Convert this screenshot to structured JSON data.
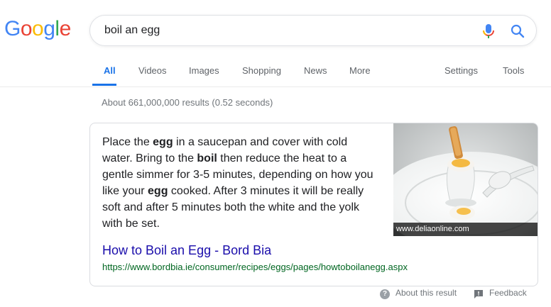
{
  "logo": {
    "letters": [
      "G",
      "o",
      "o",
      "g",
      "l",
      "e"
    ],
    "colors": [
      "#4285f4",
      "#ea4335",
      "#fbbc05",
      "#4285f4",
      "#34a853",
      "#ea4335"
    ]
  },
  "search": {
    "query": "boil an egg"
  },
  "tabs": [
    {
      "label": "All",
      "active": true
    },
    {
      "label": "Videos"
    },
    {
      "label": "Images"
    },
    {
      "label": "Shopping"
    },
    {
      "label": "News"
    },
    {
      "label": "More"
    },
    {
      "label": "Settings"
    },
    {
      "label": "Tools"
    }
  ],
  "stats": "About 661,000,000 results (0.52 seconds)",
  "featured": {
    "snippet_parts": [
      {
        "text": "Place the ",
        "bold": false
      },
      {
        "text": "egg",
        "bold": true
      },
      {
        "text": " in a saucepan and cover with cold water. Bring to the ",
        "bold": false
      },
      {
        "text": "boil",
        "bold": true
      },
      {
        "text": " then reduce the heat to a gentle simmer for 3-5 minutes, depending on how you like your ",
        "bold": false
      },
      {
        "text": "egg",
        "bold": true
      },
      {
        "text": " cooked. After 3 minutes it will be really soft and after 5 minutes both the white and the yolk with be set.",
        "bold": false
      }
    ],
    "image_caption": "www.deliaonline.com",
    "title": "How to Boil an Egg - Bord Bia",
    "url": "https://www.bordbia.ie/consumer/recipes/eggs/pages/howtoboilanegg.aspx"
  },
  "footer": {
    "about_label": "About this result",
    "feedback_label": "Feedback"
  },
  "icons": [
    "microphone-icon",
    "search-icon",
    "question-icon",
    "feedback-icon"
  ]
}
